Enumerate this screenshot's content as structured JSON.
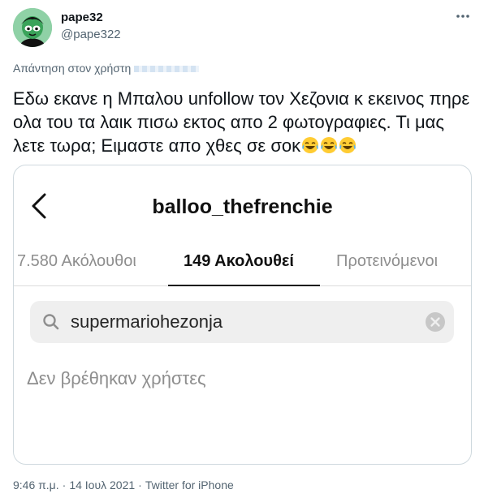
{
  "author": {
    "display_name": "pape32",
    "handle": "@pape322",
    "avatar_icon": "cartoon-avatar",
    "avatar_bg": "#7fc99a"
  },
  "reply_to_label": "Απάντηση στον χρήστη",
  "tweet": {
    "text": "Εδω εκανε η Μπαλου unfollow τον Χεζονια κ εκεινος πηρε ολα του τα λαικ πισω εκτος απο 2 φωτογραφιες. Τι μας λετε τωρα; Ειμαστε απο χθες σε σοκ",
    "emoji": [
      "face-with-tears-of-joy",
      "face-with-tears-of-joy",
      "face-with-tears-of-joy"
    ]
  },
  "screenshot": {
    "profile_name": "balloo_thefrenchie",
    "tabs": [
      {
        "label": "7.580 Ακόλουθοι",
        "active": false
      },
      {
        "label": "149 Ακολουθεί",
        "active": true
      },
      {
        "label": "Προτεινόμενοι",
        "active": false
      }
    ],
    "search_value": "supermariohezonja",
    "empty_message": "Δεν βρέθηκαν χρήστες"
  },
  "meta": {
    "time": "9:46 π.μ.",
    "date": "14 Ιουλ 2021",
    "source": "Twitter for iPhone",
    "separator": "·"
  }
}
